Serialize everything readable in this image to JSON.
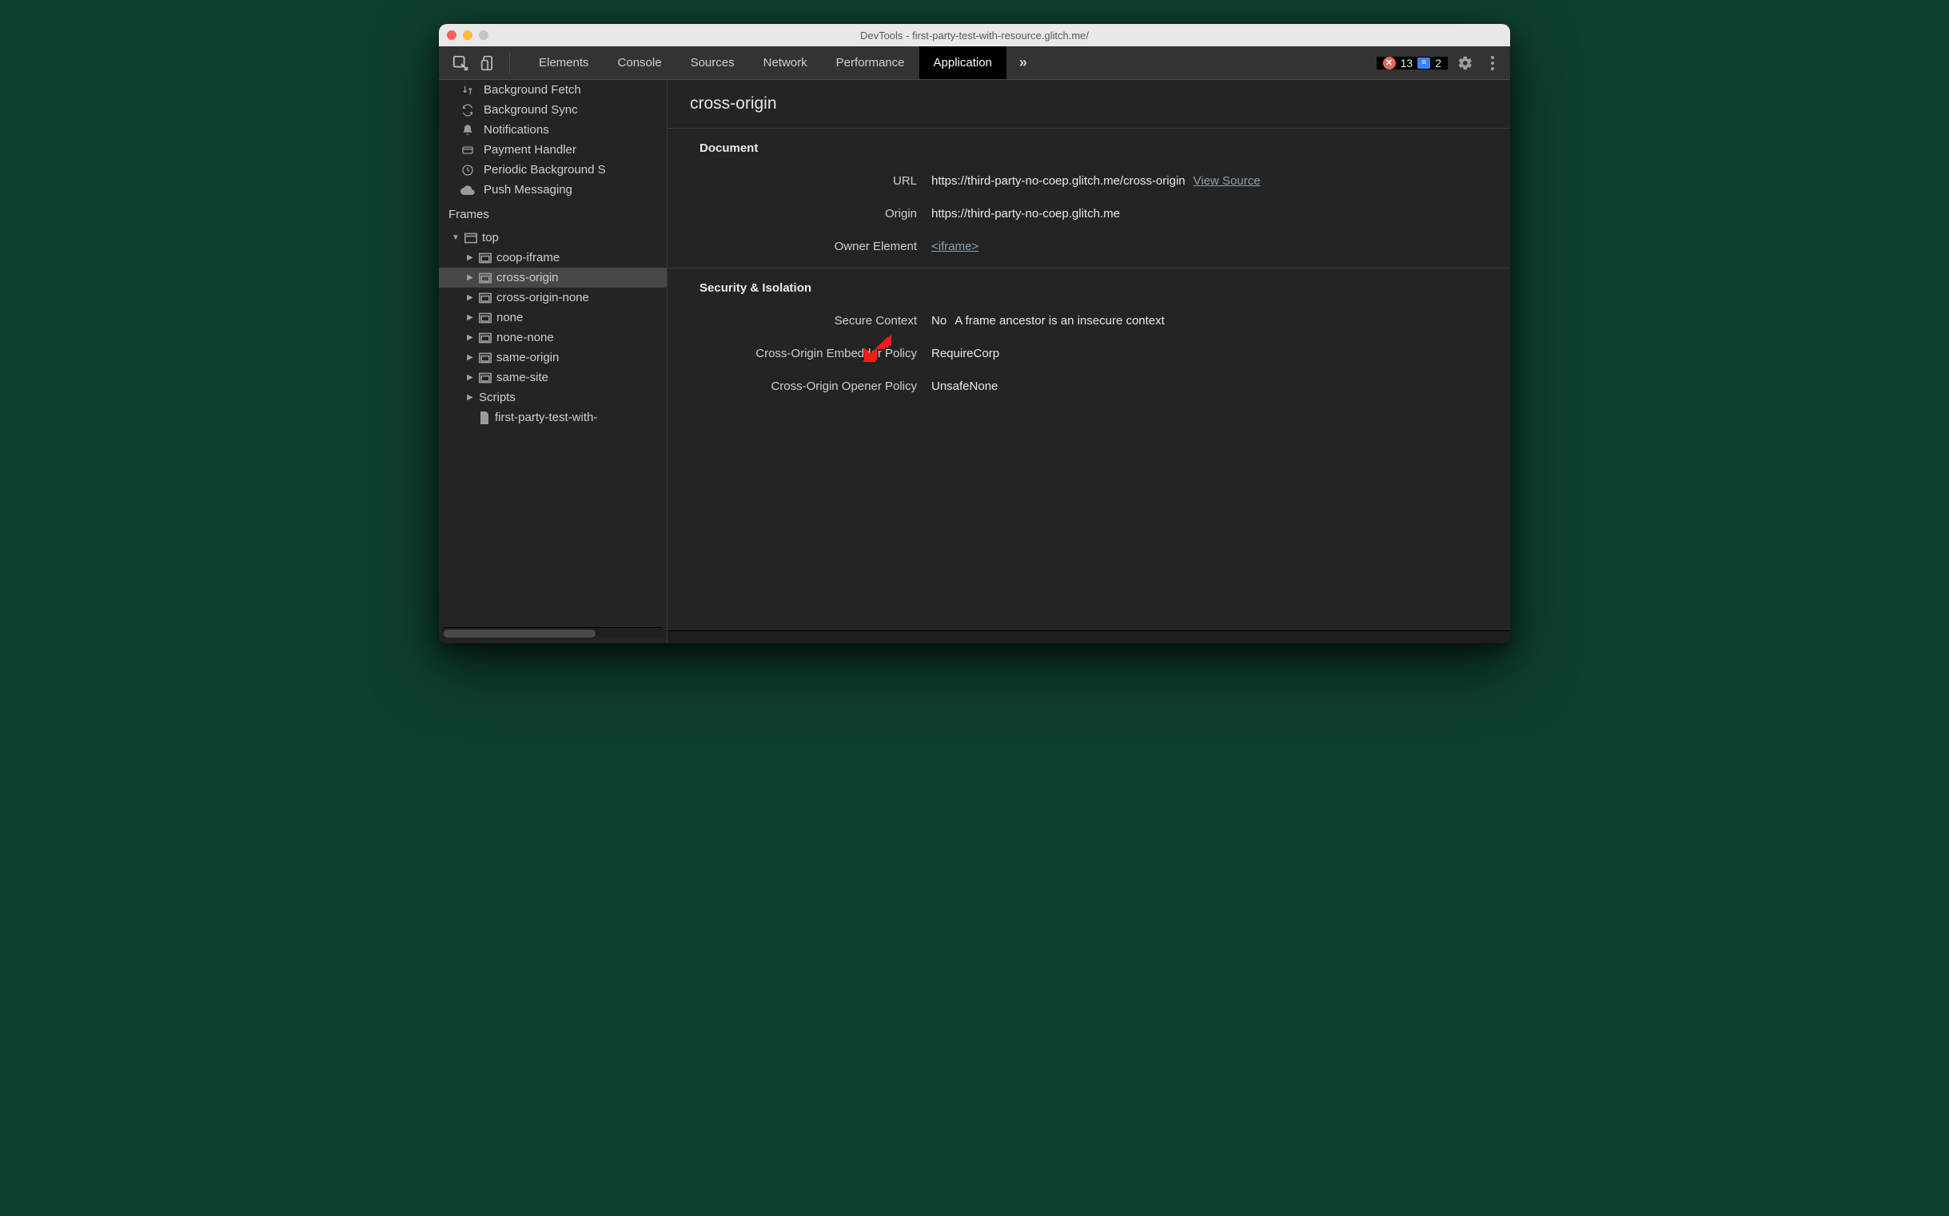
{
  "window": {
    "title": "DevTools - first-party-test-with-resource.glitch.me/"
  },
  "tabs": {
    "items": [
      "Elements",
      "Console",
      "Sources",
      "Network",
      "Performance",
      "Application"
    ],
    "active_index": 5,
    "more_glyph": "»"
  },
  "counters": {
    "errors": "13",
    "info": "2"
  },
  "sidebar": {
    "bg_items": [
      {
        "icon": "updown",
        "label": "Background Fetch"
      },
      {
        "icon": "sync",
        "label": "Background Sync"
      },
      {
        "icon": "bell",
        "label": "Notifications"
      },
      {
        "icon": "card",
        "label": "Payment Handler"
      },
      {
        "icon": "clock",
        "label": "Periodic Background S"
      },
      {
        "icon": "cloud",
        "label": "Push Messaging"
      }
    ],
    "frames_header": "Frames",
    "tree": {
      "root_label": "top",
      "children": [
        {
          "label": "coop-iframe",
          "icon": "frame"
        },
        {
          "label": "cross-origin",
          "icon": "frame",
          "selected": true
        },
        {
          "label": "cross-origin-none",
          "icon": "frame"
        },
        {
          "label": "none",
          "icon": "frame"
        },
        {
          "label": "none-none",
          "icon": "frame"
        },
        {
          "label": "same-origin",
          "icon": "frame"
        },
        {
          "label": "same-site",
          "icon": "frame"
        },
        {
          "label": "Scripts",
          "icon": "none"
        },
        {
          "label": "first-party-test-with-",
          "icon": "doc",
          "noarrow": true
        }
      ]
    }
  },
  "detail": {
    "title": "cross-origin",
    "document_section": "Document",
    "url_label": "URL",
    "url_value": "https://third-party-no-coep.glitch.me/cross-origin",
    "view_source_label": "View Source",
    "origin_label": "Origin",
    "origin_value": "https://third-party-no-coep.glitch.me",
    "owner_label": "Owner Element",
    "owner_value": "<iframe>",
    "security_section": "Security & Isolation",
    "secure_context_label": "Secure Context",
    "secure_context_value": "No",
    "secure_context_note": "A frame ancestor is an insecure context",
    "coep_label": "Cross-Origin Embedder Policy",
    "coep_value": "RequireCorp",
    "coop_label": "Cross-Origin Opener Policy",
    "coop_value": "UnsafeNone"
  },
  "annotation": {
    "arrow_color": "#ff1a1a"
  }
}
